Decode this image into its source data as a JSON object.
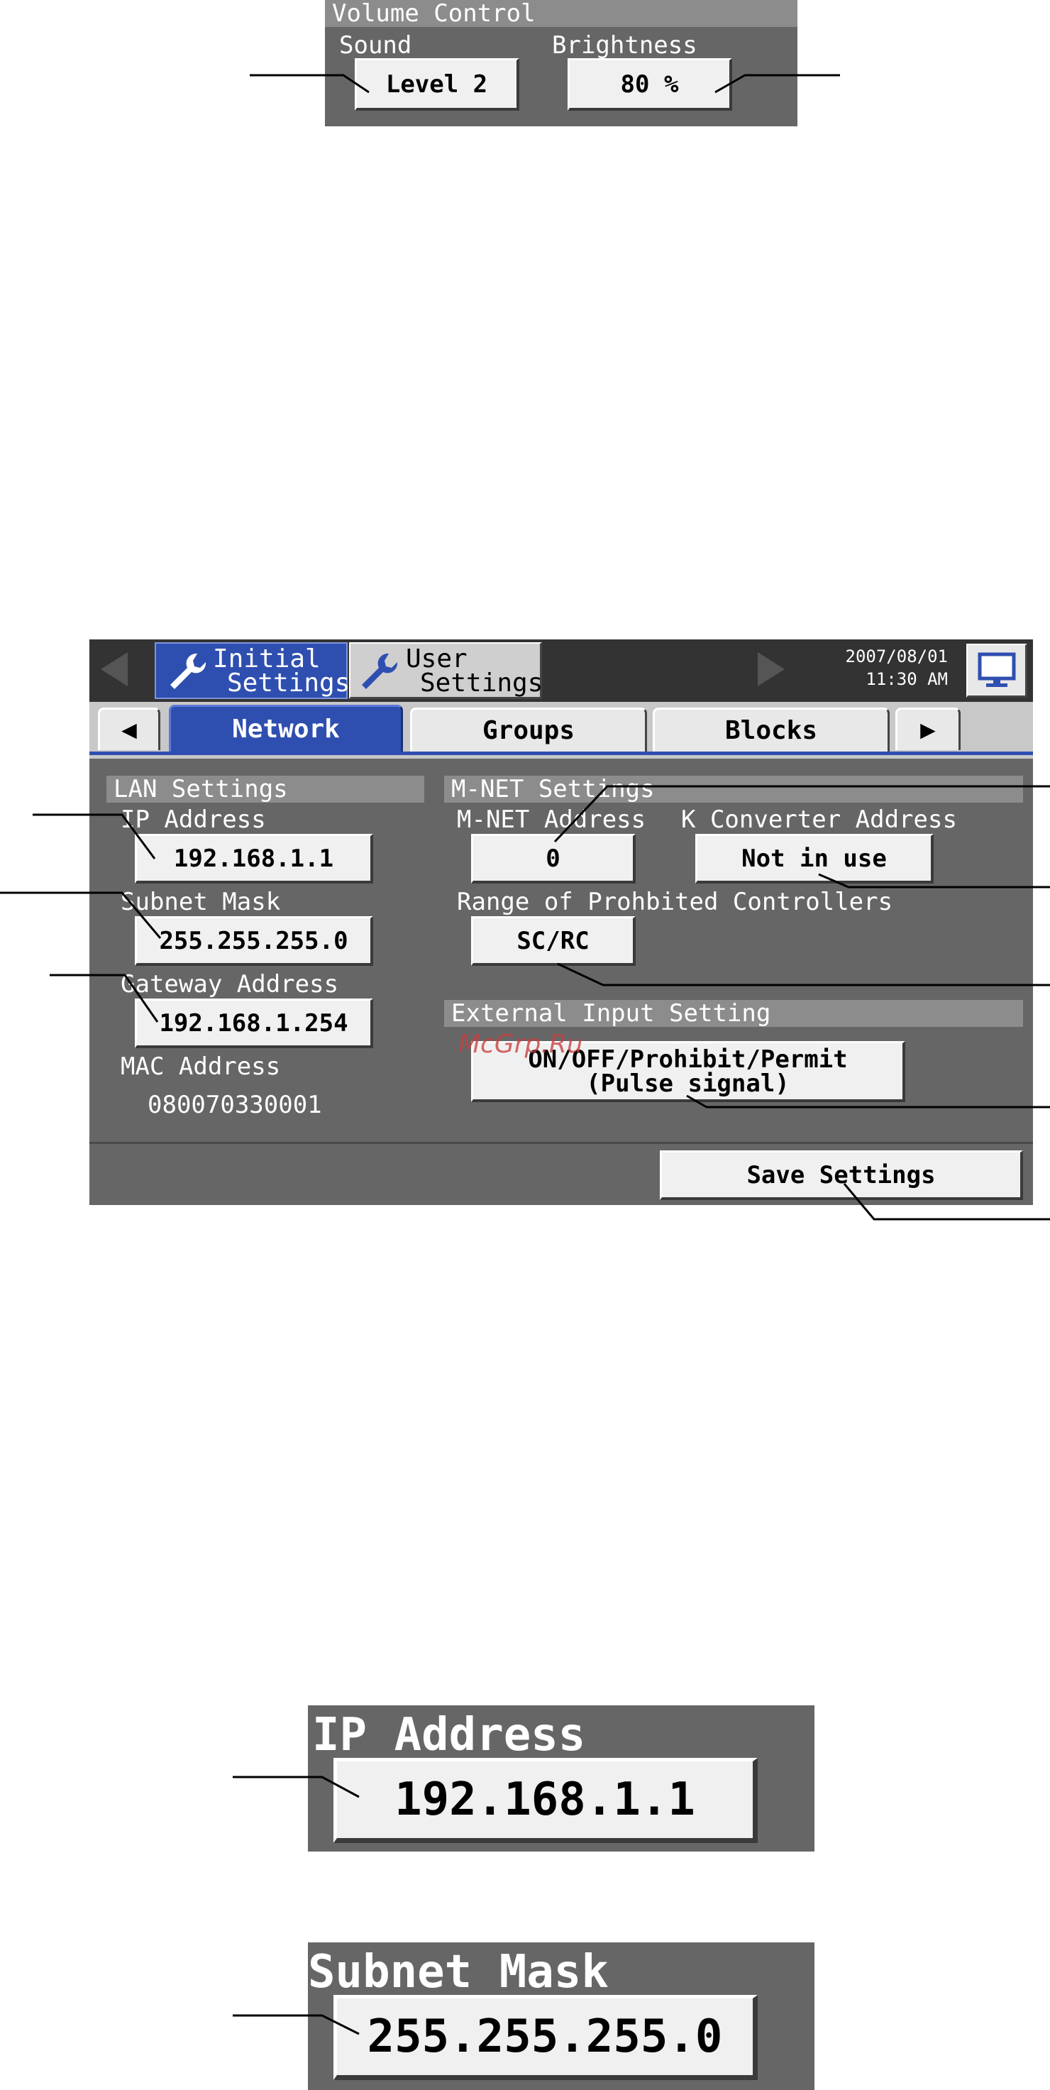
{
  "volume": {
    "title": "Volume Control",
    "sound_label": "Sound",
    "sound_value": "Level 2",
    "brightness_label": "Brightness",
    "brightness_value": "80 %"
  },
  "header": {
    "initial_settings_line1": "Initial",
    "initial_settings_line2": "Settings",
    "user_settings_line1": "User",
    "user_settings_line2": "Settings",
    "date": "2007/08/01",
    "time": "11:30 AM"
  },
  "tabs": {
    "prev": "◀",
    "network": "Network",
    "groups": "Groups",
    "blocks": "Blocks",
    "next": "▶"
  },
  "lan": {
    "title": "LAN Settings",
    "ip_label": "IP Address",
    "ip_value": "192.168.1.1",
    "subnet_label": "Subnet Mask",
    "subnet_value": "255.255.255.0",
    "gateway_label": "Gateway Address",
    "gateway_value": "192.168.1.254",
    "mac_label": "MAC Address",
    "mac_value": "080070330001"
  },
  "mnet": {
    "title": "M-NET Settings",
    "address_label": "M-NET Address",
    "address_value": "0",
    "kconv_label": "K Converter Address",
    "kconv_value": "Not in use",
    "range_label": "Range of Prohbited Controllers",
    "range_value": "SC/RC"
  },
  "external": {
    "title": "External Input Setting",
    "value_line1": "ON/OFF/Prohibit/Permit",
    "value_line2": "(Pulse signal)"
  },
  "save_label": "Save Settings",
  "watermark": "McGrp.Ru",
  "zoom_ip": {
    "label": "IP Address",
    "value": "192.168.1.1"
  },
  "zoom_subnet": {
    "label": "Subnet Mask",
    "value": "255.255.255.0"
  },
  "colors": {
    "panel": "#666666",
    "header_dark": "#333333",
    "tab_active": "#2f4fb0",
    "button_face": "#f0f0f0"
  }
}
